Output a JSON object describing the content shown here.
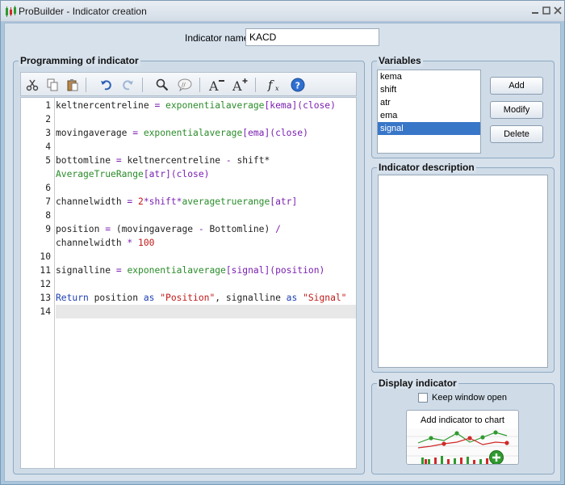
{
  "window": {
    "title": "ProBuilder - Indicator creation",
    "min_icon": "minimize-icon",
    "max_icon": "maximize-icon",
    "close_icon": "close-icon"
  },
  "indicator_name": {
    "label": "Indicator name",
    "value": "KACD"
  },
  "programming": {
    "title": "Programming of indicator",
    "toolbar_icons": [
      "cut-icon",
      "copy-icon",
      "paste-icon",
      "undo-icon",
      "redo-icon",
      "search-icon",
      "comment-icon",
      "decrease-font-icon",
      "increase-font-icon",
      "function-icon",
      "help-icon"
    ],
    "lines": [
      {
        "num": "1",
        "tokens": [
          [
            "keltnercentreline ",
            ""
          ],
          [
            "= ",
            "op"
          ],
          [
            "exponentialaverage",
            "kw"
          ],
          [
            "[kema](close)",
            "op"
          ]
        ]
      },
      {
        "num": "2",
        "tokens": []
      },
      {
        "num": "3",
        "tokens": [
          [
            "movingaverage ",
            ""
          ],
          [
            "= ",
            "op"
          ],
          [
            "exponentialaverage",
            "kw"
          ],
          [
            "[ema](close)",
            "op"
          ]
        ]
      },
      {
        "num": "4",
        "tokens": []
      },
      {
        "num": "5",
        "tokens": [
          [
            "bottomline ",
            ""
          ],
          [
            "= ",
            "op"
          ],
          [
            "keltnercentreline ",
            ""
          ],
          [
            "- ",
            "op"
          ],
          [
            "shift*",
            ""
          ]
        ]
      },
      {
        "num": "",
        "tokens": [
          [
            "AverageTrueRange",
            "kw"
          ],
          [
            "[atr](close)",
            "op"
          ]
        ]
      },
      {
        "num": "6",
        "tokens": []
      },
      {
        "num": "7",
        "tokens": [
          [
            "channelwidth ",
            ""
          ],
          [
            "= ",
            "op"
          ],
          [
            "2",
            "str"
          ],
          [
            "*shift*",
            "op"
          ],
          [
            "averagetruerange",
            "kw"
          ],
          [
            "[atr]",
            "op"
          ]
        ]
      },
      {
        "num": "8",
        "tokens": []
      },
      {
        "num": "9",
        "tokens": [
          [
            "position ",
            ""
          ],
          [
            "= ",
            "op"
          ],
          [
            "(movingaverage ",
            ""
          ],
          [
            "- ",
            "op"
          ],
          [
            "Bottomline) ",
            ""
          ],
          [
            "/",
            "op"
          ]
        ]
      },
      {
        "num": "",
        "tokens": [
          [
            "channelwidth ",
            ""
          ],
          [
            "* ",
            "op"
          ],
          [
            "100",
            "str"
          ]
        ]
      },
      {
        "num": "10",
        "tokens": []
      },
      {
        "num": "11",
        "tokens": [
          [
            "signalline ",
            ""
          ],
          [
            "= ",
            "op"
          ],
          [
            "exponentialaverage",
            "kw"
          ],
          [
            "[signal](position)",
            "op"
          ]
        ]
      },
      {
        "num": "12",
        "tokens": []
      },
      {
        "num": "13",
        "tokens": [
          [
            "Return ",
            "blue"
          ],
          [
            "position ",
            ""
          ],
          [
            "as ",
            "blue"
          ],
          [
            "\"Position\"",
            "str"
          ],
          [
            ", signalline ",
            ""
          ],
          [
            "as ",
            "blue"
          ],
          [
            "\"Signal\"",
            "str"
          ]
        ]
      },
      {
        "num": "14",
        "tokens": [],
        "active": true
      }
    ]
  },
  "variables": {
    "title": "Variables",
    "items": [
      "kema",
      "shift",
      "atr",
      "ema",
      "signal"
    ],
    "selected": "signal",
    "buttons": {
      "add": "Add",
      "modify": "Modify",
      "delete": "Delete"
    }
  },
  "description": {
    "title": "Indicator description",
    "value": ""
  },
  "display": {
    "title": "Display indicator",
    "keep_open_label": "Keep window open",
    "keep_open_checked": false,
    "add_chart_label": "Add indicator to chart"
  }
}
